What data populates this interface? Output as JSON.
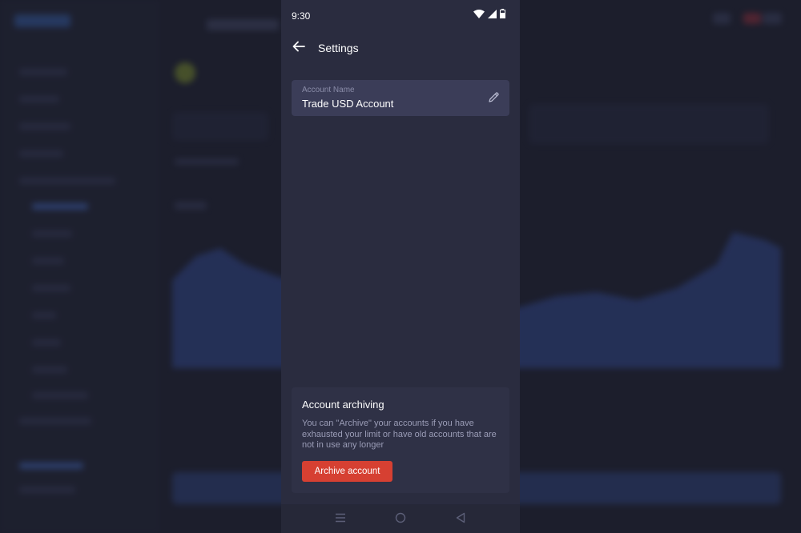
{
  "status_bar": {
    "time": "9:30",
    "icons": [
      "wifi-icon",
      "cellular-signal-icon",
      "battery-icon"
    ]
  },
  "app_bar": {
    "back_icon": "arrow-left-icon",
    "title": "Settings"
  },
  "account_name": {
    "label": "Account Name",
    "value": "Trade USD Account",
    "edit_icon": "pencil-icon"
  },
  "archiving": {
    "title": "Account archiving",
    "description": "You can \"Archive\" your accounts if you have exhausted your limit or have old accounts that are not in use any longer",
    "button_label": "Archive account"
  },
  "nav_bar": {
    "icons": [
      "recent-apps-icon",
      "home-icon",
      "back-triangle-icon"
    ]
  },
  "colors": {
    "phone_background": "#2a2c3f",
    "card_background": "#3b3d58",
    "archive_button": "#d64032",
    "backdrop": "#1c1e2c"
  }
}
